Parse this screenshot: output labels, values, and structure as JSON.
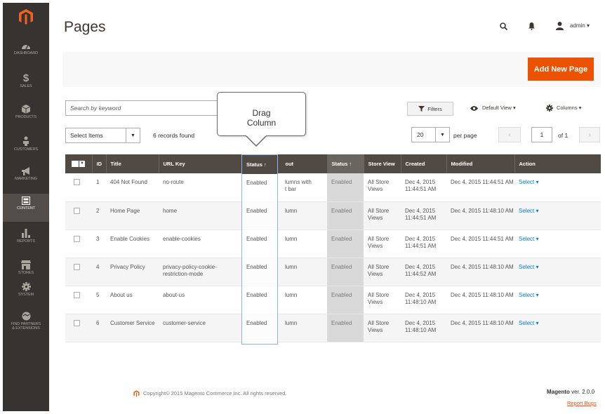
{
  "sidebar": {
    "logo": "magento-logo-icon",
    "items": [
      {
        "label": "DASHBOARD",
        "icon": "dashboard-icon"
      },
      {
        "label": "SALES",
        "icon": "dollar-icon"
      },
      {
        "label": "PRODUCTS",
        "icon": "cube-icon"
      },
      {
        "label": "CUSTOMERS",
        "icon": "person-icon"
      },
      {
        "label": "MARKETING",
        "icon": "megaphone-icon"
      },
      {
        "label": "CONTENT",
        "icon": "content-icon"
      },
      {
        "label": "REPORTS",
        "icon": "bar-chart-icon"
      },
      {
        "label": "STORES",
        "icon": "store-icon"
      },
      {
        "label": "SYSTEM",
        "icon": "gear-icon"
      },
      {
        "label": "FIND PARTNERS",
        "label2": "& EXTENSIONS",
        "icon": "partners-icon"
      }
    ]
  },
  "header": {
    "title": "Pages",
    "user": "admin"
  },
  "actions": {
    "add_new": "Add New Page"
  },
  "toolbar": {
    "search_placeholder": "Search by keyword",
    "filters": "Filters",
    "view": "Default View",
    "columns": "Columns",
    "mass_action": "Select Items",
    "records": "6 records found",
    "per_page_value": "20",
    "per_page_label": "per page",
    "page": "1",
    "of": "of 1"
  },
  "grid": {
    "columns": [
      "ID",
      "Title",
      "URL Key",
      "Status",
      "Status",
      "Store View",
      "Created",
      "Modified",
      "Action"
    ],
    "rows": [
      {
        "id": "1",
        "title": "404 Not Found",
        "url": "no-route",
        "status": "Enabled",
        "store": "All Store Views",
        "created": "Dec 4, 2015 11:44:51 AM",
        "modified": "Dec 4, 2015 11:44:51 AM",
        "action": "Select"
      },
      {
        "id": "2",
        "title": "Home Page",
        "url": "home",
        "status": "Enabled",
        "store": "All Store Views",
        "created": "Dec 4, 2015 11:44:51 AM",
        "modified": "Dec 4, 2015 11:48:10 AM",
        "action": "Select"
      },
      {
        "id": "3",
        "title": "Enable Cookies",
        "url": "enable-cookies",
        "status": "Enabled",
        "store": "All Store Views",
        "created": "Dec 4, 2015 11:44:51 AM",
        "modified": "Dec 4, 2015 11:44:51 AM",
        "action": "Select"
      },
      {
        "id": "4",
        "title": "Privacy Policy",
        "url": "privacy-policy-cookie-restriction-mode",
        "status": "Enabled",
        "store": "All Store Views",
        "created": "Dec 4, 2015 11:44:52 AM",
        "modified": "Dec 4, 2015 11:48:10 AM",
        "action": "Select"
      },
      {
        "id": "5",
        "title": "About us",
        "url": "about-us",
        "status": "Enabled",
        "store": "All Store Views",
        "created": "Dec 4, 2015 11:48:10 AM",
        "modified": "Dec 4, 2015 11:48:10 AM",
        "action": "Select"
      },
      {
        "id": "6",
        "title": "Customer Service",
        "url": "customer-service",
        "status": "Enabled",
        "store": "All Store Views",
        "created": "Dec 4, 2015 11:48:10 AM",
        "modified": "Dec 4, 2015 11:48:10 AM",
        "action": "Select"
      }
    ],
    "layout_fragments": [
      "lumns with",
      "t bar",
      "lumn",
      "lumn",
      "lumn",
      "lumn",
      "lumn"
    ],
    "layout_header_fragment": "out"
  },
  "drag": {
    "line1": "Drag",
    "line2": "Column",
    "header": "Status"
  },
  "footer": {
    "copyright": "Copyright© 2015 Magento Commerce Inc. All rights reserved.",
    "brand": "Magento",
    "version": "ver. 2.0.0",
    "report": "Report Bugs"
  },
  "colors": {
    "sidebar": "#373330",
    "accent": "#eb5202",
    "grid_header": "#514943",
    "link": "#007bdb"
  }
}
